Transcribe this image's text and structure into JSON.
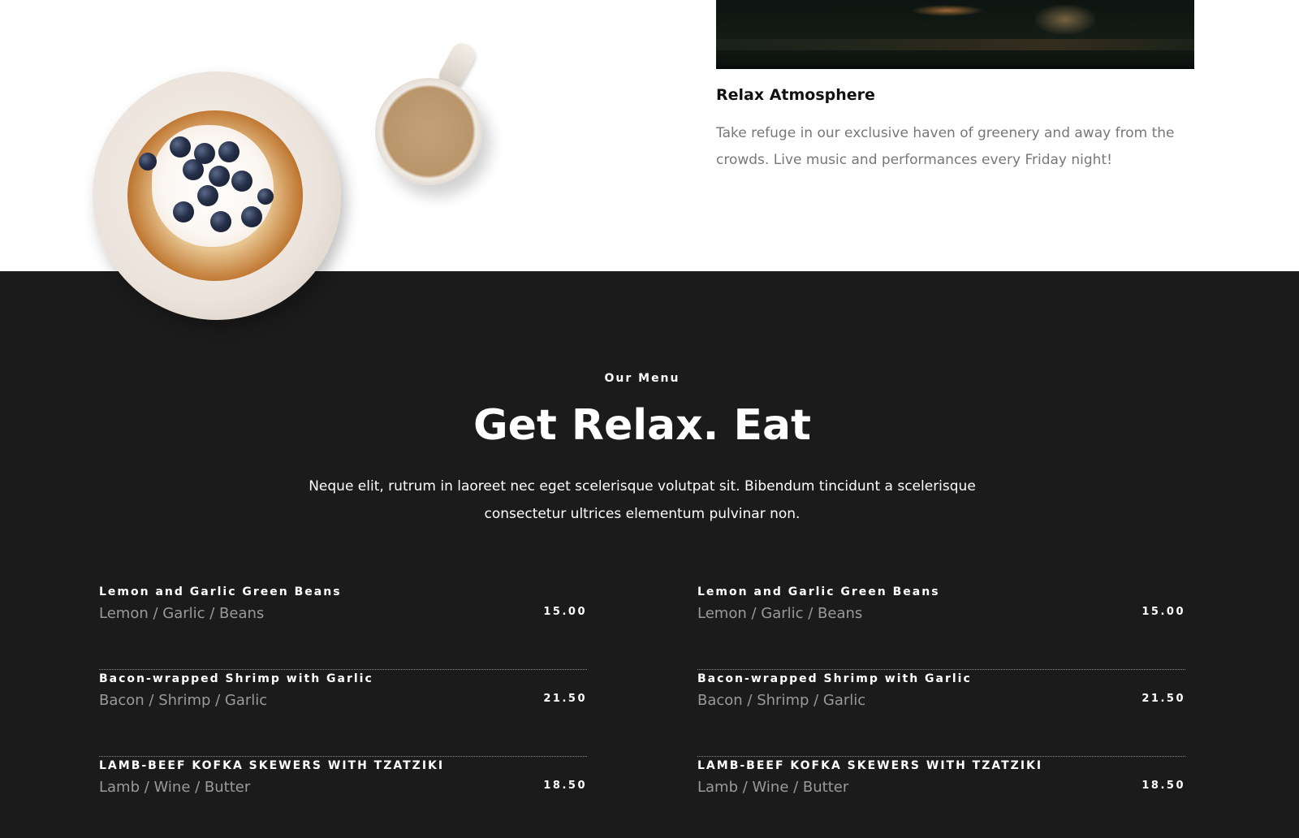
{
  "feature": {
    "title": "Relax Atmosphere",
    "text": "Take refuge in our exclusive haven of greenery and away from the crowds. Live music and performances every Friday night!"
  },
  "menu": {
    "eyebrow": "Our Menu",
    "heading": "Get Relax. Eat",
    "lead": "Neque elit, rutrum in laoreet nec eget scelerisque volutpat sit. Bibendum tincidunt a scelerisque consectetur ultrices elementum pulvinar non.",
    "left_items": [
      {
        "name": "Lemon and Garlic Green Beans",
        "desc": "Lemon / Garlic / Beans",
        "price": "15.00"
      },
      {
        "name": "Bacon-wrapped Shrimp with Garlic",
        "desc": "Bacon / Shrimp / Garlic",
        "price": "21.50"
      },
      {
        "name": "LAMB-BEEF KOFKA SKEWERS WITH TZATZIKI",
        "desc": "Lamb / Wine / Butter",
        "price": "18.50"
      }
    ],
    "right_items": [
      {
        "name": "Lemon and Garlic Green Beans",
        "desc": "Lemon / Garlic / Beans",
        "price": "15.00"
      },
      {
        "name": "Bacon-wrapped Shrimp with Garlic",
        "desc": "Bacon / Shrimp / Garlic",
        "price": "21.50"
      },
      {
        "name": "LAMB-BEEF KOFKA SKEWERS WITH TZATZIKI",
        "desc": "Lamb / Wine / Butter",
        "price": "18.50"
      }
    ]
  },
  "colors": {
    "dark_background": "#1b1b1b",
    "muted_text": "#777777",
    "menu_description": "#9a9a9a"
  },
  "icons": {
    "decor_plate": "pancake-plate-image",
    "decor_cup": "coffee-cup-image",
    "bar_photo": "bar-interior-photo"
  }
}
